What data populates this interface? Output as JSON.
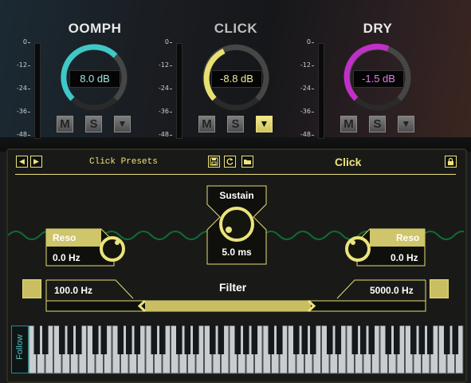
{
  "colors": {
    "accent": "#ece37c",
    "oomph": "#3fc8c8",
    "click": "#e8e070",
    "dry": "#c030c8"
  },
  "modules": [
    {
      "title": "OOMPH",
      "value": "8.0 dB",
      "color": "#3fc8c8",
      "title_color": "#e8e8e8",
      "buttons": [
        "M",
        "S",
        "▼"
      ]
    },
    {
      "title": "CLICK",
      "value": "-8.8 dB",
      "color": "#e8e070",
      "title_color": "#bdbdbd",
      "buttons": [
        "M",
        "S",
        "▼"
      ]
    },
    {
      "title": "DRY",
      "value": "-1.5 dB",
      "color": "#c030c8",
      "title_color": "#e8e8e8",
      "buttons": [
        "M",
        "S",
        "▼"
      ]
    }
  ],
  "meter_scale": [
    "0",
    "-12",
    "-24",
    "-36",
    "-48"
  ],
  "meter_scale_right": [
    "0",
    "-12",
    "-24",
    "-36",
    "-48"
  ],
  "panel": {
    "presets_label": "Click Presets",
    "title": "Click",
    "prev_icon": "◀",
    "next_icon": "▶",
    "save_icon": "save-icon",
    "refresh_icon": "refresh-icon",
    "folder_icon": "folder-icon",
    "lock_icon": "lock-icon",
    "sustain": {
      "label": "Sustain",
      "value": "5.0 ms"
    },
    "reso_left": {
      "label": "Reso",
      "value": "0.0 Hz"
    },
    "reso_right": {
      "label": "Reso",
      "value": "0.0 Hz"
    },
    "filter": {
      "label": "Filter",
      "low": "100.0 Hz",
      "high": "5000.0 Hz"
    },
    "follow": "Follow"
  }
}
